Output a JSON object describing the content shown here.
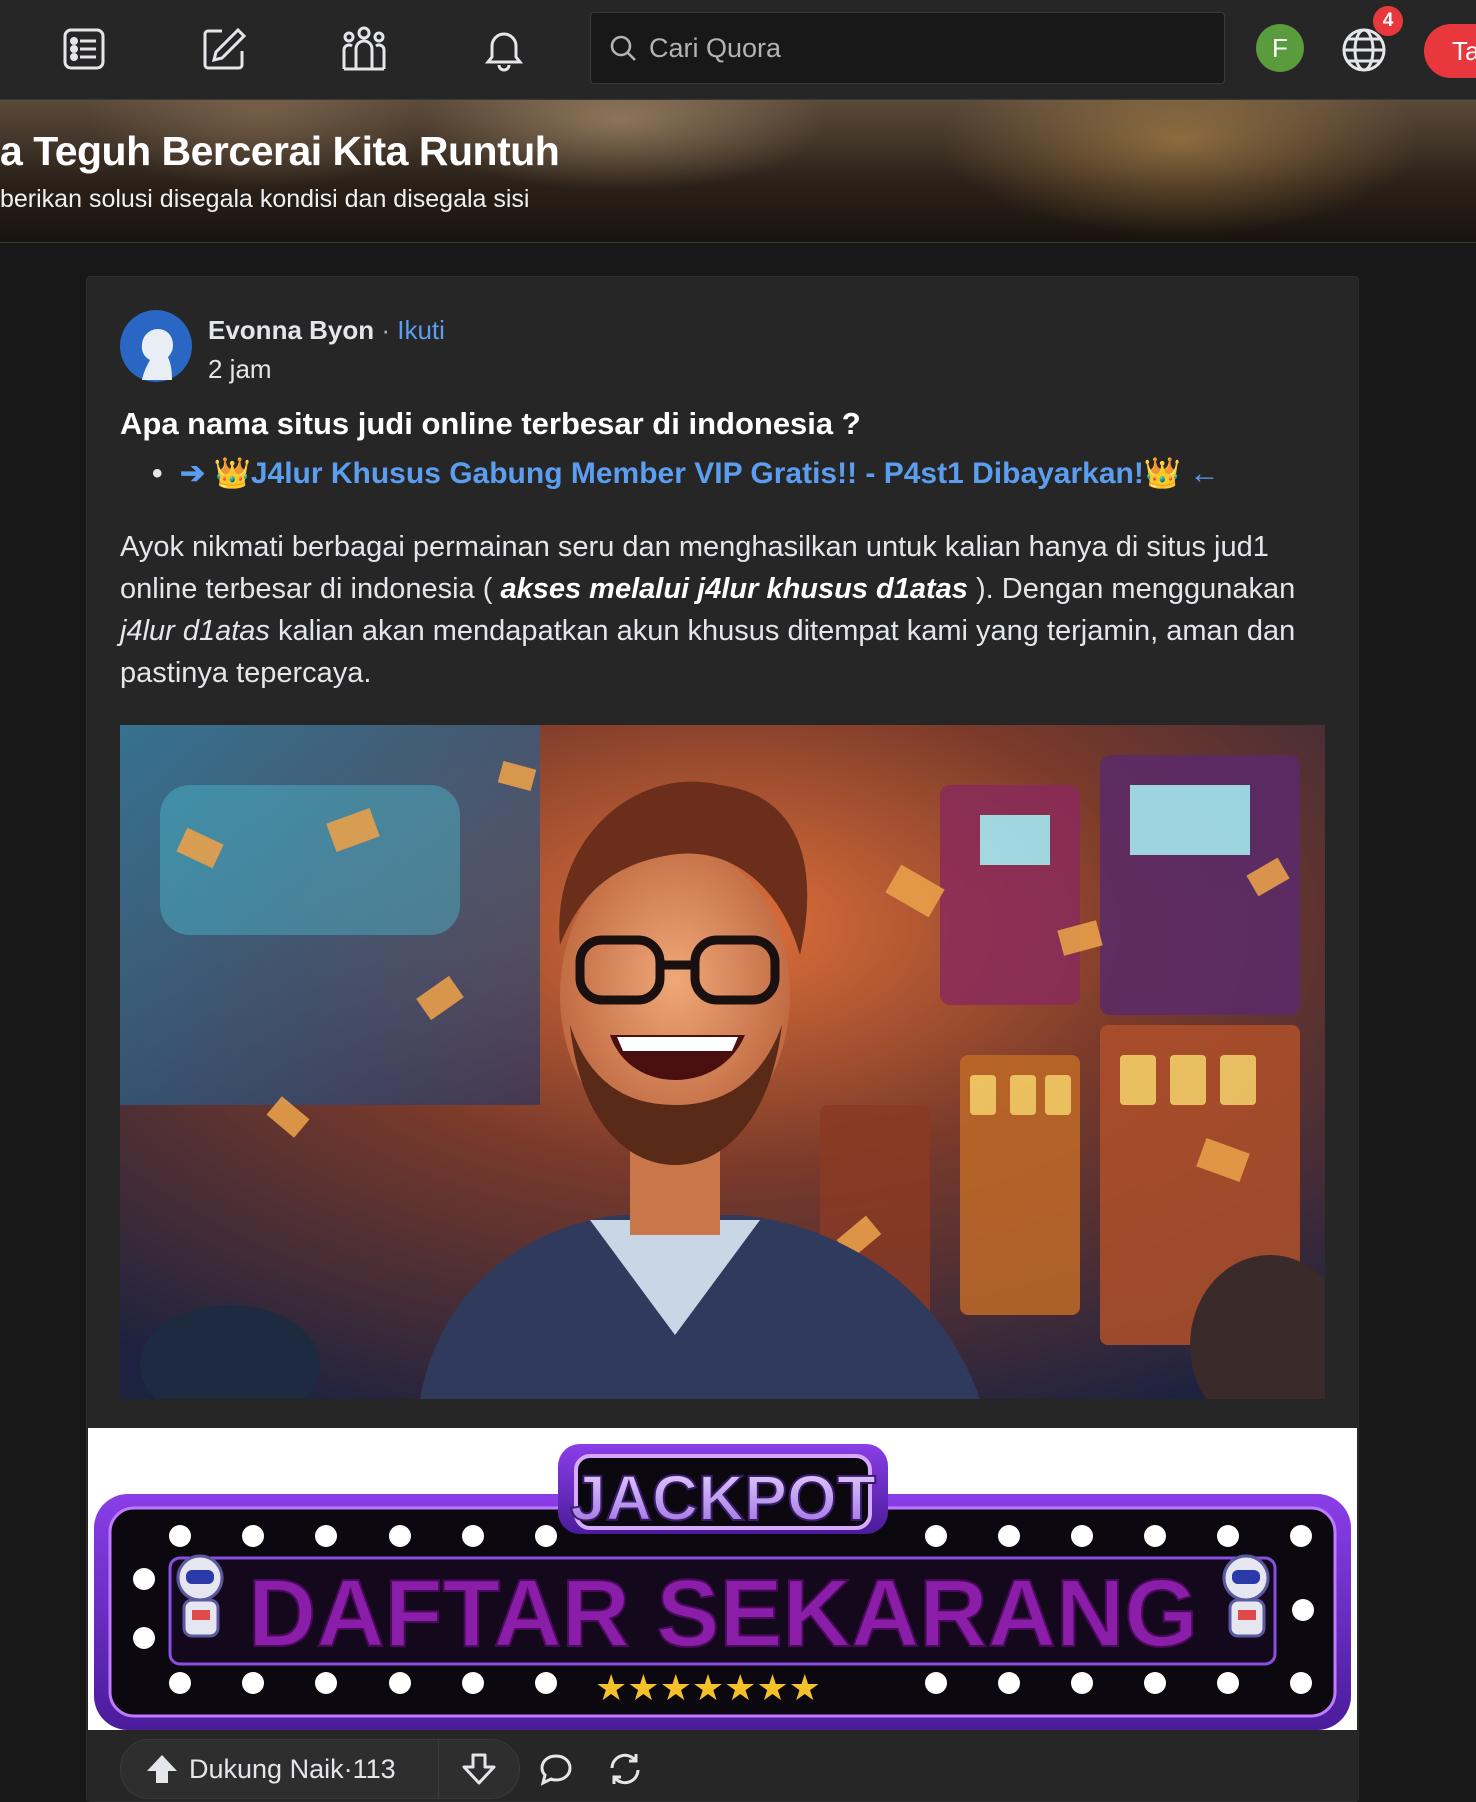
{
  "nav": {
    "items": [
      {
        "icon": "home-feed-icon"
      },
      {
        "icon": "write-answer-icon"
      },
      {
        "icon": "spaces-icon"
      },
      {
        "icon": "notifications-bell-icon"
      }
    ],
    "search_placeholder": "Cari Quora",
    "avatar_letter": "F",
    "avatar_color": "#5a9b3d",
    "language_badge": "4",
    "cta_label": "Ta",
    "accent_red": "#e8383d"
  },
  "space": {
    "title": "a Teguh Bercerai Kita Runtuh",
    "subtitle": "berikan solusi disegala kondisi dan disegala sisi"
  },
  "post": {
    "author": "Evonna Byon",
    "separator": " · ",
    "follow_label": "Ikuti",
    "time": "2 jam",
    "question": "Apa nama situs judi online terbesar di indonesia ?",
    "link_text": "➔ 👑J4lur Khusus Gabung Member VIP Gratis!! - P4st1 Dibayarkan!👑 ←",
    "link_color": "#5b9ef0",
    "body": {
      "p1": "Ayok nikmati berbagai permainan seru dan menghasilkan untuk kalian hanya di situs jud1 online terbesar di indonesia ( ",
      "em1": "akses melalui j4lur khusus d1atas",
      "p2": " ). Dengan menggunakan ",
      "em2": "j4lur d1atas",
      "p3": " kalian akan mendapatkan akun khusus ditempat kami yang terjamin, aman dan pastinya tepercaya."
    },
    "banner_top_text": "JACKPOT",
    "banner_main_text": "DAFTAR SEKARANG",
    "banner_stars": "★★★★★★★"
  },
  "actions": {
    "upvote_label": "Dukung Naik",
    "upvote_separator": " · ",
    "upvote_count": "113",
    "icons": [
      "downvote-icon",
      "comment-icon",
      "share-reshare-icon"
    ]
  }
}
